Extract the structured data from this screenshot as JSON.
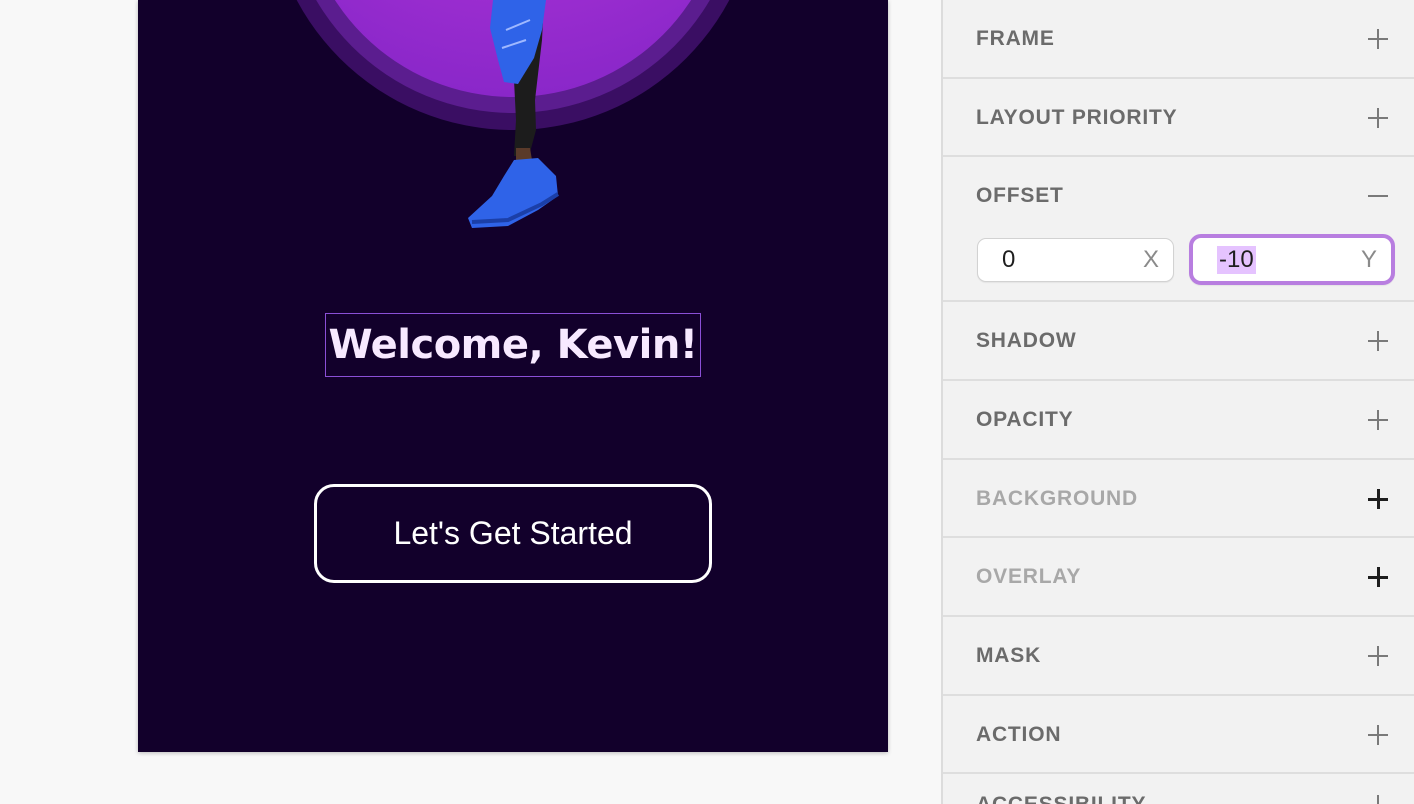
{
  "canvas": {
    "welcome_text": "Welcome, Kevin!",
    "cta_label": "Let's Get Started",
    "colors": {
      "screen_bg": "#12002b",
      "selection": "#8a4fd6",
      "hero_circle": "#a533d6"
    }
  },
  "inspector": {
    "sections": [
      {
        "title": "FRAME",
        "toggle": "plus-icon"
      },
      {
        "title": "LAYOUT PRIORITY",
        "toggle": "plus-icon"
      },
      {
        "title": "OFFSET",
        "toggle": "minus-icon"
      },
      {
        "title": "SHADOW",
        "toggle": "plus-icon"
      },
      {
        "title": "OPACITY",
        "toggle": "plus-icon"
      },
      {
        "title": "BACKGROUND",
        "toggle": "plus-icon"
      },
      {
        "title": "OVERLAY",
        "toggle": "plus-icon"
      },
      {
        "title": "MASK",
        "toggle": "plus-icon"
      },
      {
        "title": "ACTION",
        "toggle": "plus-icon"
      },
      {
        "title": "ACCESSIBILITY",
        "toggle": "plus-icon"
      }
    ],
    "offset": {
      "x_value": "0",
      "x_label": "X",
      "y_value": "-10",
      "y_label": "Y"
    },
    "colors": {
      "focus_ring": "#b87ee0",
      "selection_highlight": "#e5c3ff"
    }
  }
}
